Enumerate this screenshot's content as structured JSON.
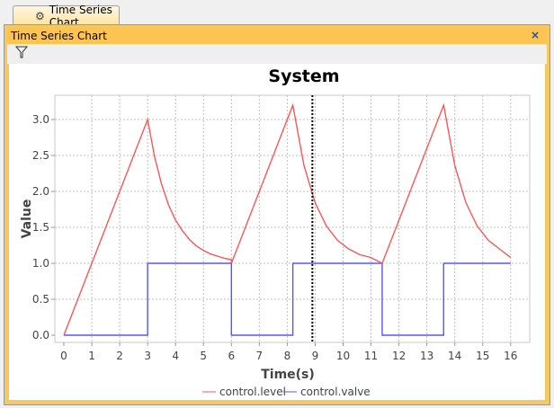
{
  "tab": {
    "label": "Time Series Chart",
    "icon": "chart-gear-icon"
  },
  "panel": {
    "title": "Time Series Chart",
    "close_label": "×",
    "toolbar_icon": "filter-icon"
  },
  "colors": {
    "level": "#ff5555",
    "valve": "#5555ff",
    "accent": "#fec451"
  },
  "chart_data": {
    "type": "line",
    "title": "System",
    "xlabel": "Time(s)",
    "ylabel": "Value",
    "xlim": [
      0,
      16.7
    ],
    "ylim": [
      0,
      3.35
    ],
    "xticks": [
      "0",
      "1",
      "2",
      "3",
      "4",
      "5",
      "6",
      "7",
      "8",
      "9",
      "10",
      "11",
      "12",
      "13",
      "14",
      "15",
      "16"
    ],
    "yticks": [
      "0.0",
      "0.5",
      "1.0",
      "1.5",
      "2.0",
      "2.5",
      "3.0"
    ],
    "grid": true,
    "cursor_x": 8.9,
    "legend_position": "bottom",
    "series": [
      {
        "name": "control.level",
        "x": [
          0,
          3,
          3.25,
          3.5,
          3.75,
          4,
          4.25,
          4.5,
          4.75,
          5,
          5.25,
          5.5,
          5.75,
          6,
          6.0,
          8.2,
          8.6,
          9.0,
          9.4,
          9.8,
          10.2,
          10.6,
          11.0,
          11.4,
          13.6,
          14.0,
          14.4,
          14.8,
          15.2,
          15.6,
          16.0
        ],
        "y": [
          0,
          3.0,
          2.48,
          2.1,
          1.81,
          1.6,
          1.45,
          1.33,
          1.24,
          1.18,
          1.13,
          1.1,
          1.07,
          1.05,
          1.0,
          3.2,
          2.36,
          1.84,
          1.52,
          1.32,
          1.2,
          1.12,
          1.08,
          1.0,
          3.2,
          2.36,
          1.84,
          1.52,
          1.32,
          1.2,
          1.08
        ]
      },
      {
        "name": "control.valve",
        "x": [
          0,
          3,
          3,
          6,
          6,
          8.2,
          8.2,
          11.4,
          11.4,
          13.6,
          13.6,
          16
        ],
        "y": [
          0,
          0,
          1,
          1,
          0,
          0,
          1,
          1,
          0,
          0,
          1,
          1
        ]
      }
    ]
  }
}
